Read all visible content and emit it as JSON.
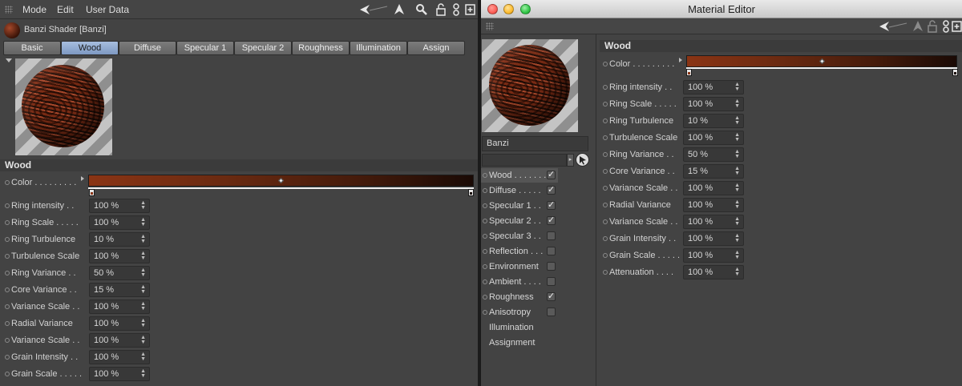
{
  "left": {
    "menus": [
      "Mode",
      "Edit",
      "User Data"
    ],
    "shader_title": "Banzi Shader [Banzi]",
    "tabs": [
      {
        "label": "Basic",
        "active": false
      },
      {
        "label": "Wood",
        "active": true
      },
      {
        "label": "Diffuse",
        "active": false
      },
      {
        "label": "Specular 1",
        "active": false
      },
      {
        "label": "Specular 2",
        "active": false
      },
      {
        "label": "Roughness",
        "active": false
      },
      {
        "label": "Illumination",
        "active": false
      },
      {
        "label": "Assign",
        "active": false
      }
    ],
    "section_title": "Wood",
    "color_label": "Color . . . . . . . . .",
    "params": [
      {
        "label": "Ring intensity . .",
        "value": "100 %"
      },
      {
        "label": "Ring Scale  . . . . .",
        "value": "100 %"
      },
      {
        "label": "Ring Turbulence",
        "value": "10 %"
      },
      {
        "label": "Turbulence Scale",
        "value": "100 %"
      },
      {
        "label": "Ring Variance . .",
        "value": "50 %"
      },
      {
        "label": "Core Variance  . .",
        "value": "15 %"
      },
      {
        "label": "Variance Scale . .",
        "value": "100 %"
      },
      {
        "label": "Radial Variance",
        "value": "100 %"
      },
      {
        "label": "Variance Scale . .",
        "value": "100 %"
      },
      {
        "label": "Grain Intensity . .",
        "value": "100 %"
      },
      {
        "label": "Grain Scale . . . . .",
        "value": "100 %"
      }
    ]
  },
  "right": {
    "window_title": "Material Editor",
    "material_name": "Banzi",
    "channels": [
      {
        "label": "Wood . . . . . . .",
        "checked": true,
        "has_checkbox": true,
        "selected": true
      },
      {
        "label": "Diffuse  . . . . .",
        "checked": true,
        "has_checkbox": true,
        "selected": false
      },
      {
        "label": "Specular 1  . .",
        "checked": true,
        "has_checkbox": true,
        "selected": false
      },
      {
        "label": "Specular 2  . .",
        "checked": true,
        "has_checkbox": true,
        "selected": false
      },
      {
        "label": "Specular 3  . .",
        "checked": false,
        "has_checkbox": true,
        "selected": false
      },
      {
        "label": "Reflection . . .",
        "checked": false,
        "has_checkbox": true,
        "selected": false
      },
      {
        "label": "Environment",
        "checked": false,
        "has_checkbox": true,
        "selected": false
      },
      {
        "label": "Ambient  . . . .",
        "checked": false,
        "has_checkbox": true,
        "selected": false
      },
      {
        "label": "Roughness",
        "checked": true,
        "has_checkbox": true,
        "selected": false
      },
      {
        "label": "Anisotropy",
        "checked": false,
        "has_checkbox": true,
        "selected": false
      },
      {
        "label": "Illumination",
        "checked": false,
        "has_checkbox": false,
        "selected": false
      },
      {
        "label": "Assignment",
        "checked": false,
        "has_checkbox": false,
        "selected": false
      }
    ],
    "section_title": "Wood",
    "color_label": "Color . . . . . . . . .",
    "params": [
      {
        "label": "Ring intensity . .",
        "value": "100 %"
      },
      {
        "label": "Ring Scale  . . . . .",
        "value": "100 %"
      },
      {
        "label": "Ring Turbulence",
        "value": "10 %"
      },
      {
        "label": "Turbulence Scale",
        "value": "100 %"
      },
      {
        "label": "Ring Variance . .",
        "value": "50 %"
      },
      {
        "label": "Core Variance  . .",
        "value": "15 %"
      },
      {
        "label": "Variance Scale . .",
        "value": "100 %"
      },
      {
        "label": "Radial Variance",
        "value": "100 %"
      },
      {
        "label": "Variance Scale . .",
        "value": "100 %"
      },
      {
        "label": "Grain Intensity . .",
        "value": "100 %"
      },
      {
        "label": "Grain Scale . . . . .",
        "value": "100 %"
      },
      {
        "label": "Attenuation . . . .",
        "value": "100 %"
      }
    ]
  },
  "icons": {
    "nav_back": "arrow-left-icon",
    "nav_up": "arrow-up-icon",
    "search": "search-icon",
    "lock": "lock-icon",
    "link": "link-icon",
    "new_window": "new-window-icon",
    "pick": "picker-icon"
  },
  "colors": {
    "tab_active": "#8ea8d0",
    "gradient_start": "#8a3414",
    "gradient_end": "#1a0a05",
    "traffic_red": "#fc5f57",
    "traffic_yellow": "#fdbc2f",
    "traffic_green": "#33c748"
  }
}
